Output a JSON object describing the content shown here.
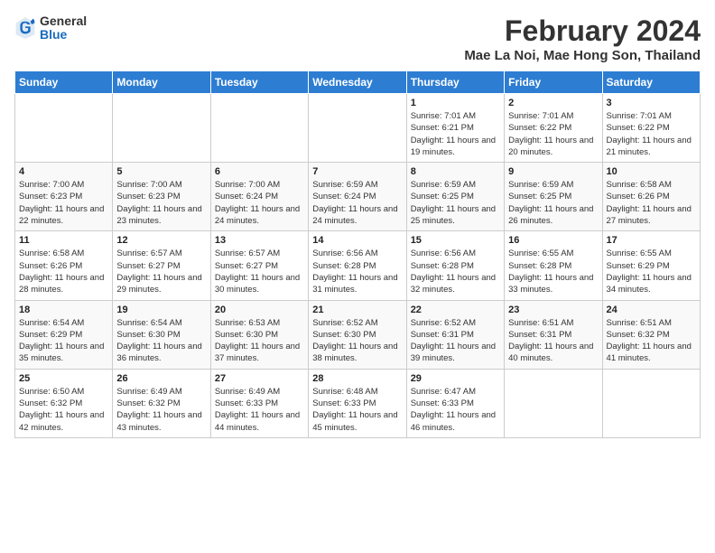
{
  "header": {
    "logo_general": "General",
    "logo_blue": "Blue",
    "month_year": "February 2024",
    "location": "Mae La Noi, Mae Hong Son, Thailand"
  },
  "weekdays": [
    "Sunday",
    "Monday",
    "Tuesday",
    "Wednesday",
    "Thursday",
    "Friday",
    "Saturday"
  ],
  "weeks": [
    [
      {
        "day": "",
        "info": ""
      },
      {
        "day": "",
        "info": ""
      },
      {
        "day": "",
        "info": ""
      },
      {
        "day": "",
        "info": ""
      },
      {
        "day": "1",
        "info": "Sunrise: 7:01 AM\nSunset: 6:21 PM\nDaylight: 11 hours and 19 minutes."
      },
      {
        "day": "2",
        "info": "Sunrise: 7:01 AM\nSunset: 6:22 PM\nDaylight: 11 hours and 20 minutes."
      },
      {
        "day": "3",
        "info": "Sunrise: 7:01 AM\nSunset: 6:22 PM\nDaylight: 11 hours and 21 minutes."
      }
    ],
    [
      {
        "day": "4",
        "info": "Sunrise: 7:00 AM\nSunset: 6:23 PM\nDaylight: 11 hours and 22 minutes."
      },
      {
        "day": "5",
        "info": "Sunrise: 7:00 AM\nSunset: 6:23 PM\nDaylight: 11 hours and 23 minutes."
      },
      {
        "day": "6",
        "info": "Sunrise: 7:00 AM\nSunset: 6:24 PM\nDaylight: 11 hours and 24 minutes."
      },
      {
        "day": "7",
        "info": "Sunrise: 6:59 AM\nSunset: 6:24 PM\nDaylight: 11 hours and 24 minutes."
      },
      {
        "day": "8",
        "info": "Sunrise: 6:59 AM\nSunset: 6:25 PM\nDaylight: 11 hours and 25 minutes."
      },
      {
        "day": "9",
        "info": "Sunrise: 6:59 AM\nSunset: 6:25 PM\nDaylight: 11 hours and 26 minutes."
      },
      {
        "day": "10",
        "info": "Sunrise: 6:58 AM\nSunset: 6:26 PM\nDaylight: 11 hours and 27 minutes."
      }
    ],
    [
      {
        "day": "11",
        "info": "Sunrise: 6:58 AM\nSunset: 6:26 PM\nDaylight: 11 hours and 28 minutes."
      },
      {
        "day": "12",
        "info": "Sunrise: 6:57 AM\nSunset: 6:27 PM\nDaylight: 11 hours and 29 minutes."
      },
      {
        "day": "13",
        "info": "Sunrise: 6:57 AM\nSunset: 6:27 PM\nDaylight: 11 hours and 30 minutes."
      },
      {
        "day": "14",
        "info": "Sunrise: 6:56 AM\nSunset: 6:28 PM\nDaylight: 11 hours and 31 minutes."
      },
      {
        "day": "15",
        "info": "Sunrise: 6:56 AM\nSunset: 6:28 PM\nDaylight: 11 hours and 32 minutes."
      },
      {
        "day": "16",
        "info": "Sunrise: 6:55 AM\nSunset: 6:28 PM\nDaylight: 11 hours and 33 minutes."
      },
      {
        "day": "17",
        "info": "Sunrise: 6:55 AM\nSunset: 6:29 PM\nDaylight: 11 hours and 34 minutes."
      }
    ],
    [
      {
        "day": "18",
        "info": "Sunrise: 6:54 AM\nSunset: 6:29 PM\nDaylight: 11 hours and 35 minutes."
      },
      {
        "day": "19",
        "info": "Sunrise: 6:54 AM\nSunset: 6:30 PM\nDaylight: 11 hours and 36 minutes."
      },
      {
        "day": "20",
        "info": "Sunrise: 6:53 AM\nSunset: 6:30 PM\nDaylight: 11 hours and 37 minutes."
      },
      {
        "day": "21",
        "info": "Sunrise: 6:52 AM\nSunset: 6:30 PM\nDaylight: 11 hours and 38 minutes."
      },
      {
        "day": "22",
        "info": "Sunrise: 6:52 AM\nSunset: 6:31 PM\nDaylight: 11 hours and 39 minutes."
      },
      {
        "day": "23",
        "info": "Sunrise: 6:51 AM\nSunset: 6:31 PM\nDaylight: 11 hours and 40 minutes."
      },
      {
        "day": "24",
        "info": "Sunrise: 6:51 AM\nSunset: 6:32 PM\nDaylight: 11 hours and 41 minutes."
      }
    ],
    [
      {
        "day": "25",
        "info": "Sunrise: 6:50 AM\nSunset: 6:32 PM\nDaylight: 11 hours and 42 minutes."
      },
      {
        "day": "26",
        "info": "Sunrise: 6:49 AM\nSunset: 6:32 PM\nDaylight: 11 hours and 43 minutes."
      },
      {
        "day": "27",
        "info": "Sunrise: 6:49 AM\nSunset: 6:33 PM\nDaylight: 11 hours and 44 minutes."
      },
      {
        "day": "28",
        "info": "Sunrise: 6:48 AM\nSunset: 6:33 PM\nDaylight: 11 hours and 45 minutes."
      },
      {
        "day": "29",
        "info": "Sunrise: 6:47 AM\nSunset: 6:33 PM\nDaylight: 11 hours and 46 minutes."
      },
      {
        "day": "",
        "info": ""
      },
      {
        "day": "",
        "info": ""
      }
    ]
  ]
}
